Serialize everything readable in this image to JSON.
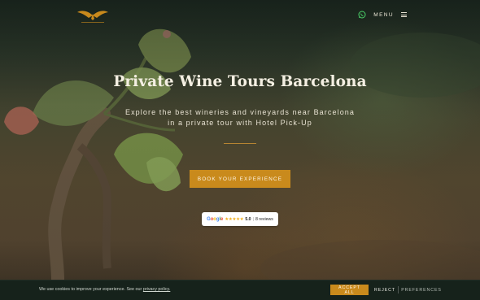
{
  "header": {
    "logo_icon": "winged-logo-icon",
    "menu_label": "MENU",
    "whatsapp_icon": "whatsapp-icon",
    "menu_icon": "hamburger-icon"
  },
  "hero": {
    "title": "Private Wine Tours Barcelona",
    "subtitle": "Explore the best wineries and vineyards near Barcelona in a private tour with Hotel Pick-Up",
    "cta_label": "BOOK YOUR EXPERIENCE"
  },
  "reviews": {
    "provider": "Google",
    "stars": "★★★★★",
    "rating": "5.0",
    "separator": "|",
    "count_label": "8 reviews"
  },
  "cookie": {
    "text": "We use cookies to improve your experience. See our",
    "link_text": "privacy policy.",
    "accept_label": "ACCEPT ALL",
    "reject_label": "REJECT",
    "preferences_label": "PREFERENCES"
  },
  "colors": {
    "accent": "#c98a1c",
    "cookie_bg": "#16221b",
    "title": "#f4efe2"
  }
}
